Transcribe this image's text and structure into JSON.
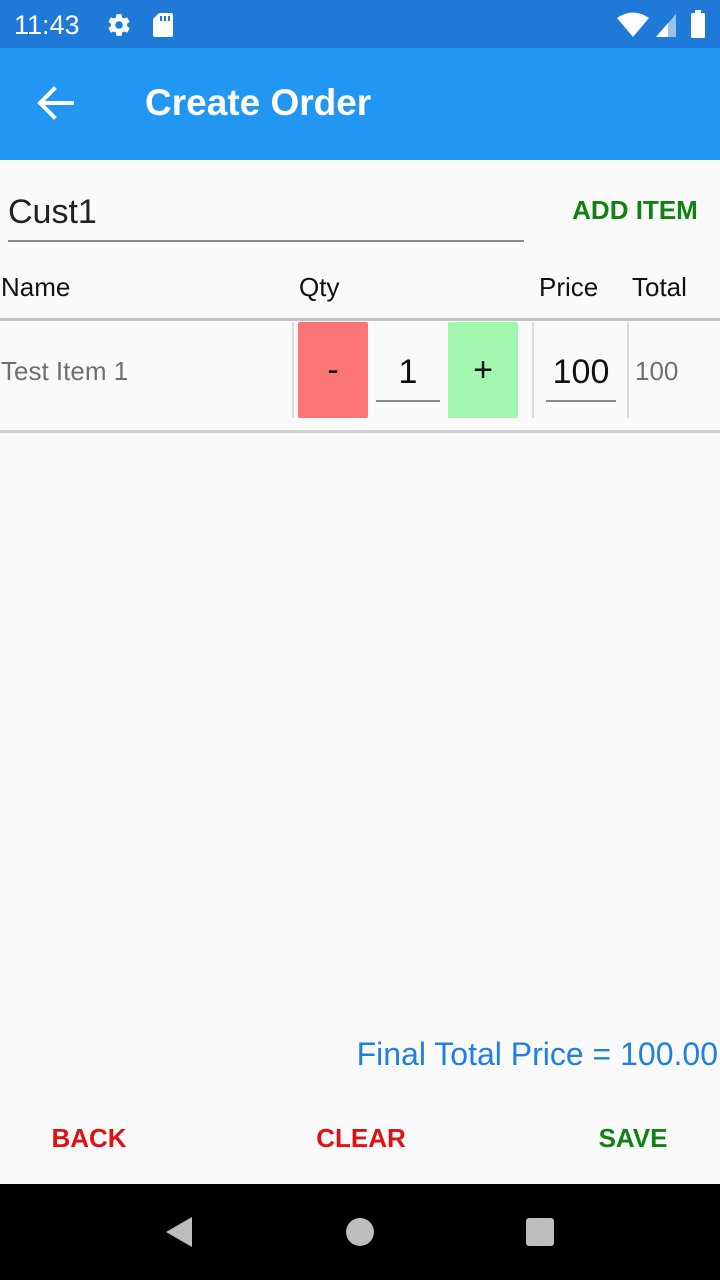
{
  "status_bar": {
    "time": "11:43"
  },
  "app_bar": {
    "title": "Create Order"
  },
  "order": {
    "customer_value": "Cust1",
    "add_item_label": "ADD ITEM"
  },
  "table": {
    "headers": {
      "name": "Name",
      "qty": "Qty",
      "price": "Price",
      "total": "Total"
    },
    "rows": [
      {
        "name": "Test Item 1",
        "minus_label": "-",
        "qty": "1",
        "plus_label": "+",
        "price": "100",
        "total": "100"
      }
    ]
  },
  "summary": {
    "final_total": "Final Total Price = 100.00"
  },
  "footer": {
    "back_label": "BACK",
    "clear_label": "CLEAR",
    "save_label": "SAVE"
  },
  "colors": {
    "status_bar": "#1e7ad6",
    "app_bar": "#2196f3",
    "minus_button": "#fa7574",
    "plus_button": "#a2f7ae",
    "green_action": "#118211",
    "red_action": "#e21111",
    "final_total": "#1f7fe3"
  },
  "icons": {
    "status": [
      "settings-gear-icon",
      "sd-card-icon",
      "wifi-icon",
      "cell-signal-icon",
      "battery-icon"
    ],
    "app_bar": "arrow-back-icon",
    "nav": [
      "nav-back-icon",
      "nav-home-icon",
      "nav-recents-icon"
    ]
  }
}
